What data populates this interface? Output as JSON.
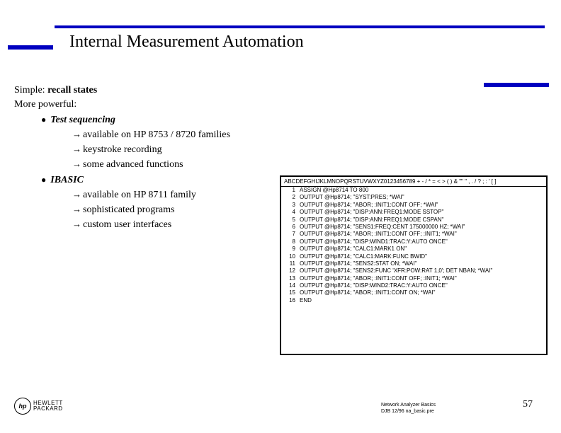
{
  "title": "Internal Measurement Automation",
  "simple": "Simple: ",
  "simple_bold": "recall states",
  "more_powerful": "More powerful:",
  "b1": "Test sequencing",
  "b1_s1": "available on HP 8753 / 8720 families",
  "b1_s2": "keystroke recording",
  "b1_s3": "some advanced functions",
  "b2": "IBASIC",
  "b2_s1": "available on HP 8711 family",
  "b2_s2": "sophisticated programs",
  "b2_s3": "custom user interfaces",
  "code_header": "ABCDEFGHIJKLMNOPQRSTUVWXYZ0123456789 + - / * = < > ( ) & \"\"  \" ,  . / ? ; : ' [ ]",
  "code": [
    "ASSIGN @Hp8714 TO 800",
    "OUTPUT @Hp8714; \"SYST:PRES; *WAI\"",
    "OUTPUT @Hp8714; \"ABOR; :INIT1:CONT OFF; *WAI\"",
    "OUTPUT @Hp8714; \"DISP:ANN:FREQ1:MODE SSTOP\"",
    "OUTPUT @Hp8714; \"DISP:ANN:FREQ1:MODE CSPAN\"",
    "OUTPUT @Hp8714; \"SENS1:FREQ:CENT 175000000 HZ; *WAI\"",
    "OUTPUT @Hp8714; \"ABOR; :INIT1:CONT OFF; :INIT1; *WAI\"",
    "OUTPUT @Hp8714; \"DISP:WIND1:TRAC:Y:AUTO ONCE\"",
    "OUTPUT @Hp8714; \"CALC1:MARK1 ON\"",
    "OUTPUT @Hp8714; \"CALC1:MARK:FUNC BWID\"",
    "OUTPUT @Hp8714; \"SENS2:STAT ON; *WAI\"",
    "OUTPUT @Hp8714; \"SENS2:FUNC 'XFR:POW:RAT 1,0'; DET NBAN; *WAI\"",
    "OUTPUT @Hp8714; \"ABOR; :INIT1:CONT OFF; :INIT1; *WAI\"",
    "OUTPUT @Hp8714; \"DISP:WIND2:TRAC:Y:AUTO ONCE\"",
    "OUTPUT @Hp8714; \"ABOR; :INIT1:CONT ON; *WAI\"",
    "END"
  ],
  "logo_hp": "hp",
  "logo_text1": "HEWLETT",
  "logo_text2": "PACKARD",
  "footer1": "Network Analyzer Basics",
  "footer2": "DJB  12/96  na_basic.pre",
  "pagenum": "57"
}
